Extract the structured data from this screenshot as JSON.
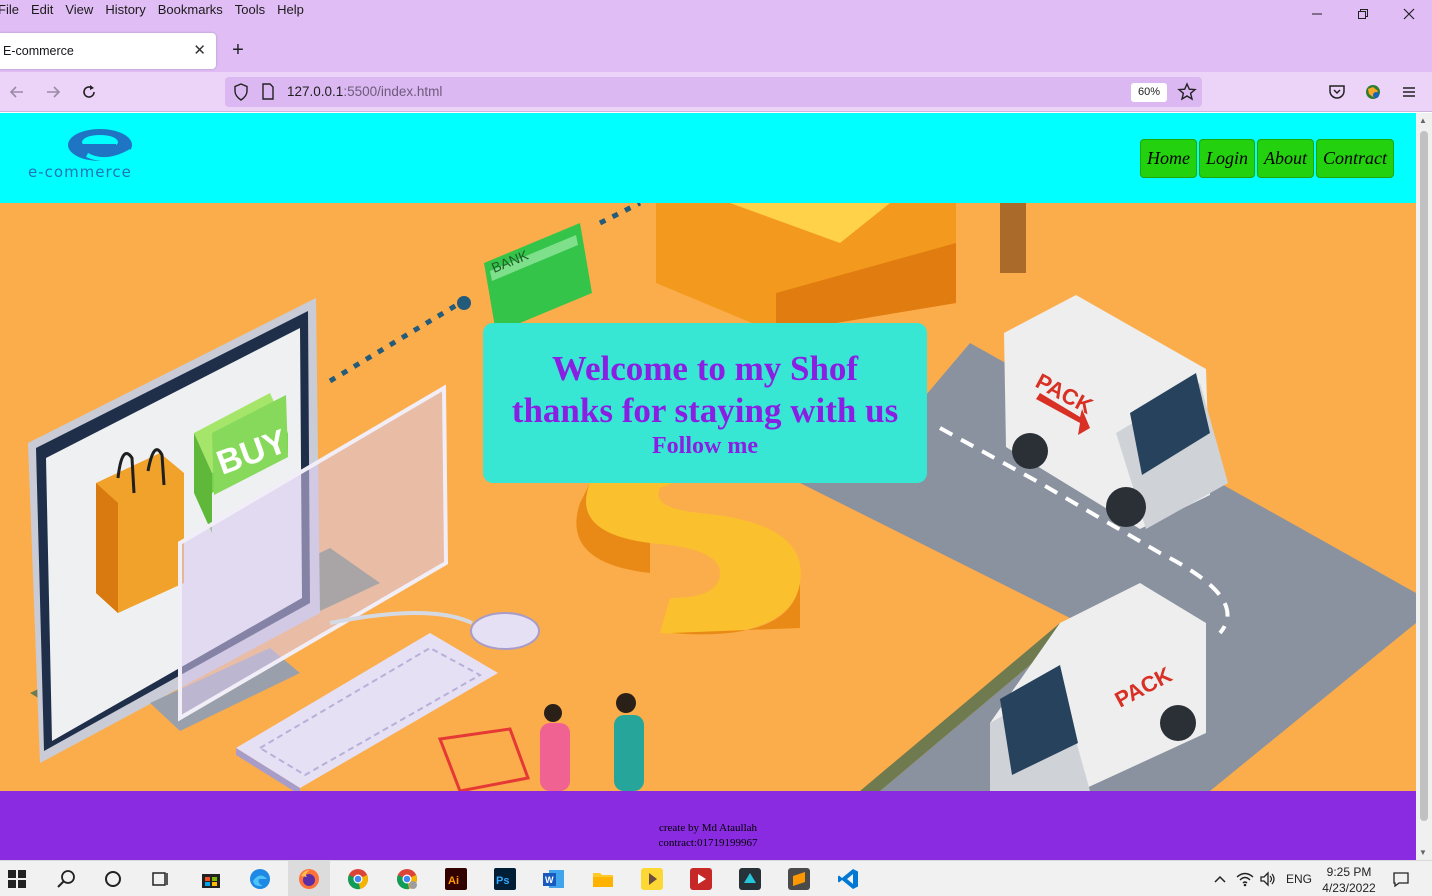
{
  "browser": {
    "menu": [
      "File",
      "Edit",
      "View",
      "History",
      "Bookmarks",
      "Tools",
      "Help"
    ],
    "tab_title": "E-commerce",
    "url_host": "127.0.0.1",
    "url_path": ":5500/index.html",
    "zoom": "60%"
  },
  "site": {
    "logo_text": "e-commerce",
    "nav": [
      "Home",
      "Login",
      "About",
      "Contract"
    ],
    "hero": {
      "line1": "Welcome to my Shof",
      "line2": "thanks for staying with us",
      "line3": "Follow me"
    },
    "footer": {
      "line1": "create by Md Ataullah",
      "line2": "contract:01719199967"
    }
  },
  "taskbar": {
    "language": "ENG",
    "time": "9:25 PM",
    "date": "4/23/2022"
  },
  "colors": {
    "header_bg": "#00ffff",
    "nav_button": "#23d10e",
    "hero_bg": "#fbad4b",
    "card_bg": "#37e6d3",
    "card_text": "#8a1ee3",
    "footer_bg": "#8a2be2",
    "chrome_bg": "#e0bdf4"
  }
}
